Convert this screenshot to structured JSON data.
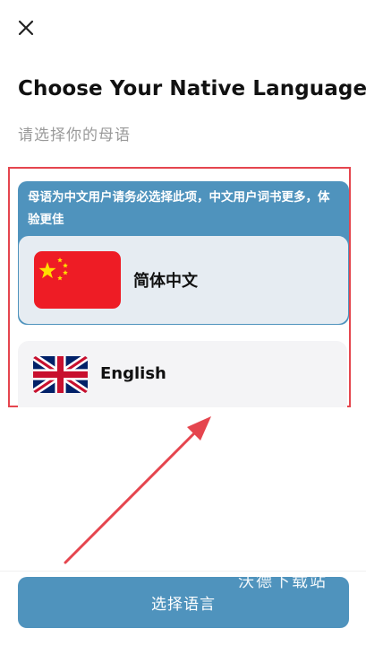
{
  "header": {
    "close_icon": "close-icon",
    "title": "Choose Your Native Language",
    "subtitle": "请选择你的母语"
  },
  "notice": {
    "text": "母语为中文用户请务必选择此项，中文用户词书更多，体验更佳"
  },
  "languages": [
    {
      "label": "简体中文",
      "flag_icon": "china-flag-icon",
      "selected": true
    },
    {
      "label": "English",
      "flag_icon": "uk-flag-icon",
      "selected": false
    }
  ],
  "footer": {
    "button_label": "选择语言"
  },
  "watermark": "沃德下载站",
  "colors": {
    "accent": "#4f93bd",
    "selected_bg": "#e6ecf2",
    "annotation_red": "#e5454e",
    "subtitle_gray": "#9a9a9a"
  }
}
